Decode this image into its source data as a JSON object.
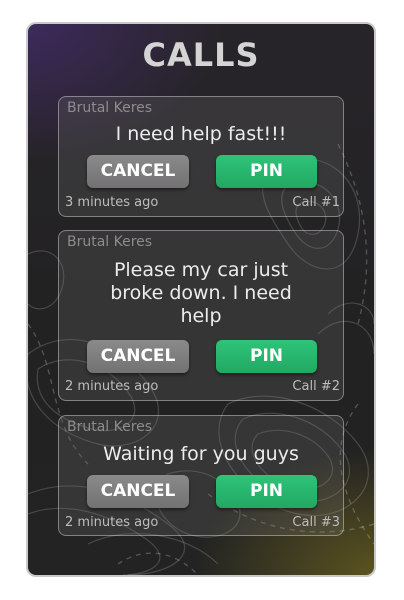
{
  "title": "CALLS",
  "colors": {
    "pin_button": "#27b56c",
    "cancel_button": "#7d7d7d",
    "panel_background": "#242424"
  },
  "calls": [
    {
      "caller": "Brutal Keres",
      "message": "I need help fast!!!",
      "cancel_label": "CANCEL",
      "pin_label": "PIN",
      "time": "3 minutes ago",
      "call_number": "Call #1"
    },
    {
      "caller": "Brutal Keres",
      "message": "Please my car just broke down. I need help",
      "cancel_label": "CANCEL",
      "pin_label": "PIN",
      "time": "2 minutes ago",
      "call_number": "Call #2"
    },
    {
      "caller": "Brutal Keres",
      "message": "Waiting for you guys",
      "cancel_label": "CANCEL",
      "pin_label": "PIN",
      "time": "2 minutes ago",
      "call_number": "Call #3"
    }
  ]
}
